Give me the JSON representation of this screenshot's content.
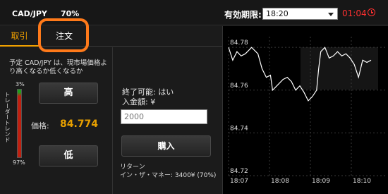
{
  "header": {
    "pair": "CAD/JPY",
    "rate": "70%",
    "expiry_label": "有効期限:",
    "expiry_value": "18:20",
    "countdown": "01:04"
  },
  "tabs": [
    {
      "label": "取引",
      "active": true
    },
    {
      "label": "注文",
      "active": false
    }
  ],
  "trade": {
    "prediction_text": "予定 CAD/JPY は、現市場価格より高くなるか低くなるか",
    "trend_label": "トレーダートレンド",
    "trend_top_pct": "3%",
    "trend_bottom_pct": "97%",
    "high_label": "高",
    "low_label": "低",
    "price_label": "価格:",
    "price_value": "84.774"
  },
  "order": {
    "available_text": "終了可能: はい",
    "amount_label": "入金額: ¥",
    "amount_placeholder": "2000",
    "buy_label": "購入",
    "return_label": "リターン",
    "return_value": "イン・ザ・マネー: 3400¥ (70%)"
  },
  "chart_data": {
    "type": "line",
    "y_ticks": [
      "84.78",
      "84.76",
      "84.74",
      "84.72"
    ],
    "x_ticks": [
      "18:07",
      "18:08",
      "18:09",
      "18:10"
    ],
    "ylim": [
      84.72,
      84.785
    ],
    "series": [
      {
        "values": [
          [
            0,
            84.78
          ],
          [
            0.1,
            84.774
          ],
          [
            0.2,
            84.778
          ],
          [
            0.3,
            84.776
          ],
          [
            0.4,
            84.777
          ],
          [
            0.55,
            84.78
          ],
          [
            0.7,
            84.777
          ],
          [
            0.8,
            84.77
          ],
          [
            0.9,
            84.766
          ],
          [
            1.0,
            84.767
          ],
          [
            1.05,
            84.76
          ],
          [
            1.2,
            84.763
          ],
          [
            1.3,
            84.765
          ],
          [
            1.4,
            84.766
          ],
          [
            1.5,
            84.764
          ],
          [
            1.6,
            84.76
          ],
          [
            1.7,
            84.762
          ],
          [
            1.8,
            84.759
          ],
          [
            1.9,
            84.755
          ],
          [
            2.0,
            84.757
          ],
          [
            2.1,
            84.76
          ],
          [
            2.15,
            84.77
          ],
          [
            2.2,
            84.778
          ],
          [
            2.3,
            84.78
          ],
          [
            2.4,
            84.775
          ],
          [
            2.5,
            84.776
          ],
          [
            2.6,
            84.778
          ],
          [
            2.7,
            84.776
          ],
          [
            2.8,
            84.777
          ],
          [
            2.9,
            84.775
          ],
          [
            3.0,
            84.772
          ],
          [
            3.1,
            84.766
          ],
          [
            3.2,
            84.774
          ],
          [
            3.3,
            84.773
          ],
          [
            3.4,
            84.774
          ]
        ]
      }
    ],
    "colors": {
      "line": "#ffffff",
      "grid": "#3a3a3a",
      "background": "#000000"
    }
  }
}
